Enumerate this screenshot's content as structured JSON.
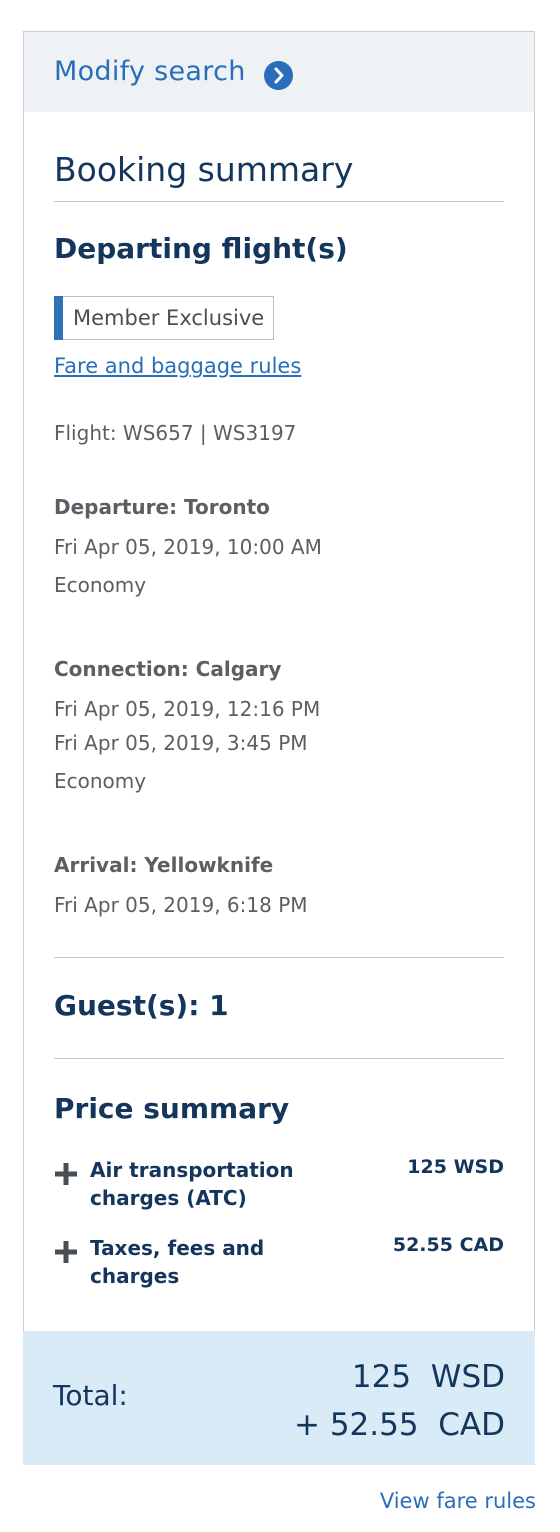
{
  "modify": {
    "label": "Modify search"
  },
  "booking": {
    "title": "Booking summary"
  },
  "departing": {
    "heading": "Departing flight(s)",
    "badge": "Member Exclusive",
    "fare_link": "Fare and baggage rules",
    "flight": "Flight: WS657 | WS3197",
    "departure": {
      "label": "Departure: Toronto",
      "datetime": "Fri Apr 05, 2019, 10:00 AM",
      "cabin": "Economy"
    },
    "connection": {
      "label": "Connection: Calgary",
      "arrive": "Fri Apr 05, 2019, 12:16 PM",
      "depart": "Fri Apr 05, 2019, 3:45 PM",
      "cabin": "Economy"
    },
    "arrival": {
      "label": "Arrival: Yellowknife",
      "datetime": "Fri Apr 05, 2019, 6:18 PM"
    }
  },
  "guests": {
    "label": "Guest(s): 1"
  },
  "price": {
    "heading": "Price summary",
    "items": [
      {
        "label": "Air transportation charges (ATC)",
        "amount": "125 WSD",
        "icon": "plus-icon"
      },
      {
        "label": "Taxes, fees and charges",
        "amount": "52.55 CAD",
        "icon": "plus-icon"
      }
    ]
  },
  "total": {
    "label": "Total:",
    "line1": "125  WSD",
    "line2": "+ 52.55  CAD"
  },
  "footer": {
    "view_fare_rules": "View fare rules"
  },
  "colors": {
    "link": "#2a6ebb",
    "heading": "#14365c",
    "total_bg": "#d8ebf7",
    "header_bg": "#eef2f4"
  }
}
